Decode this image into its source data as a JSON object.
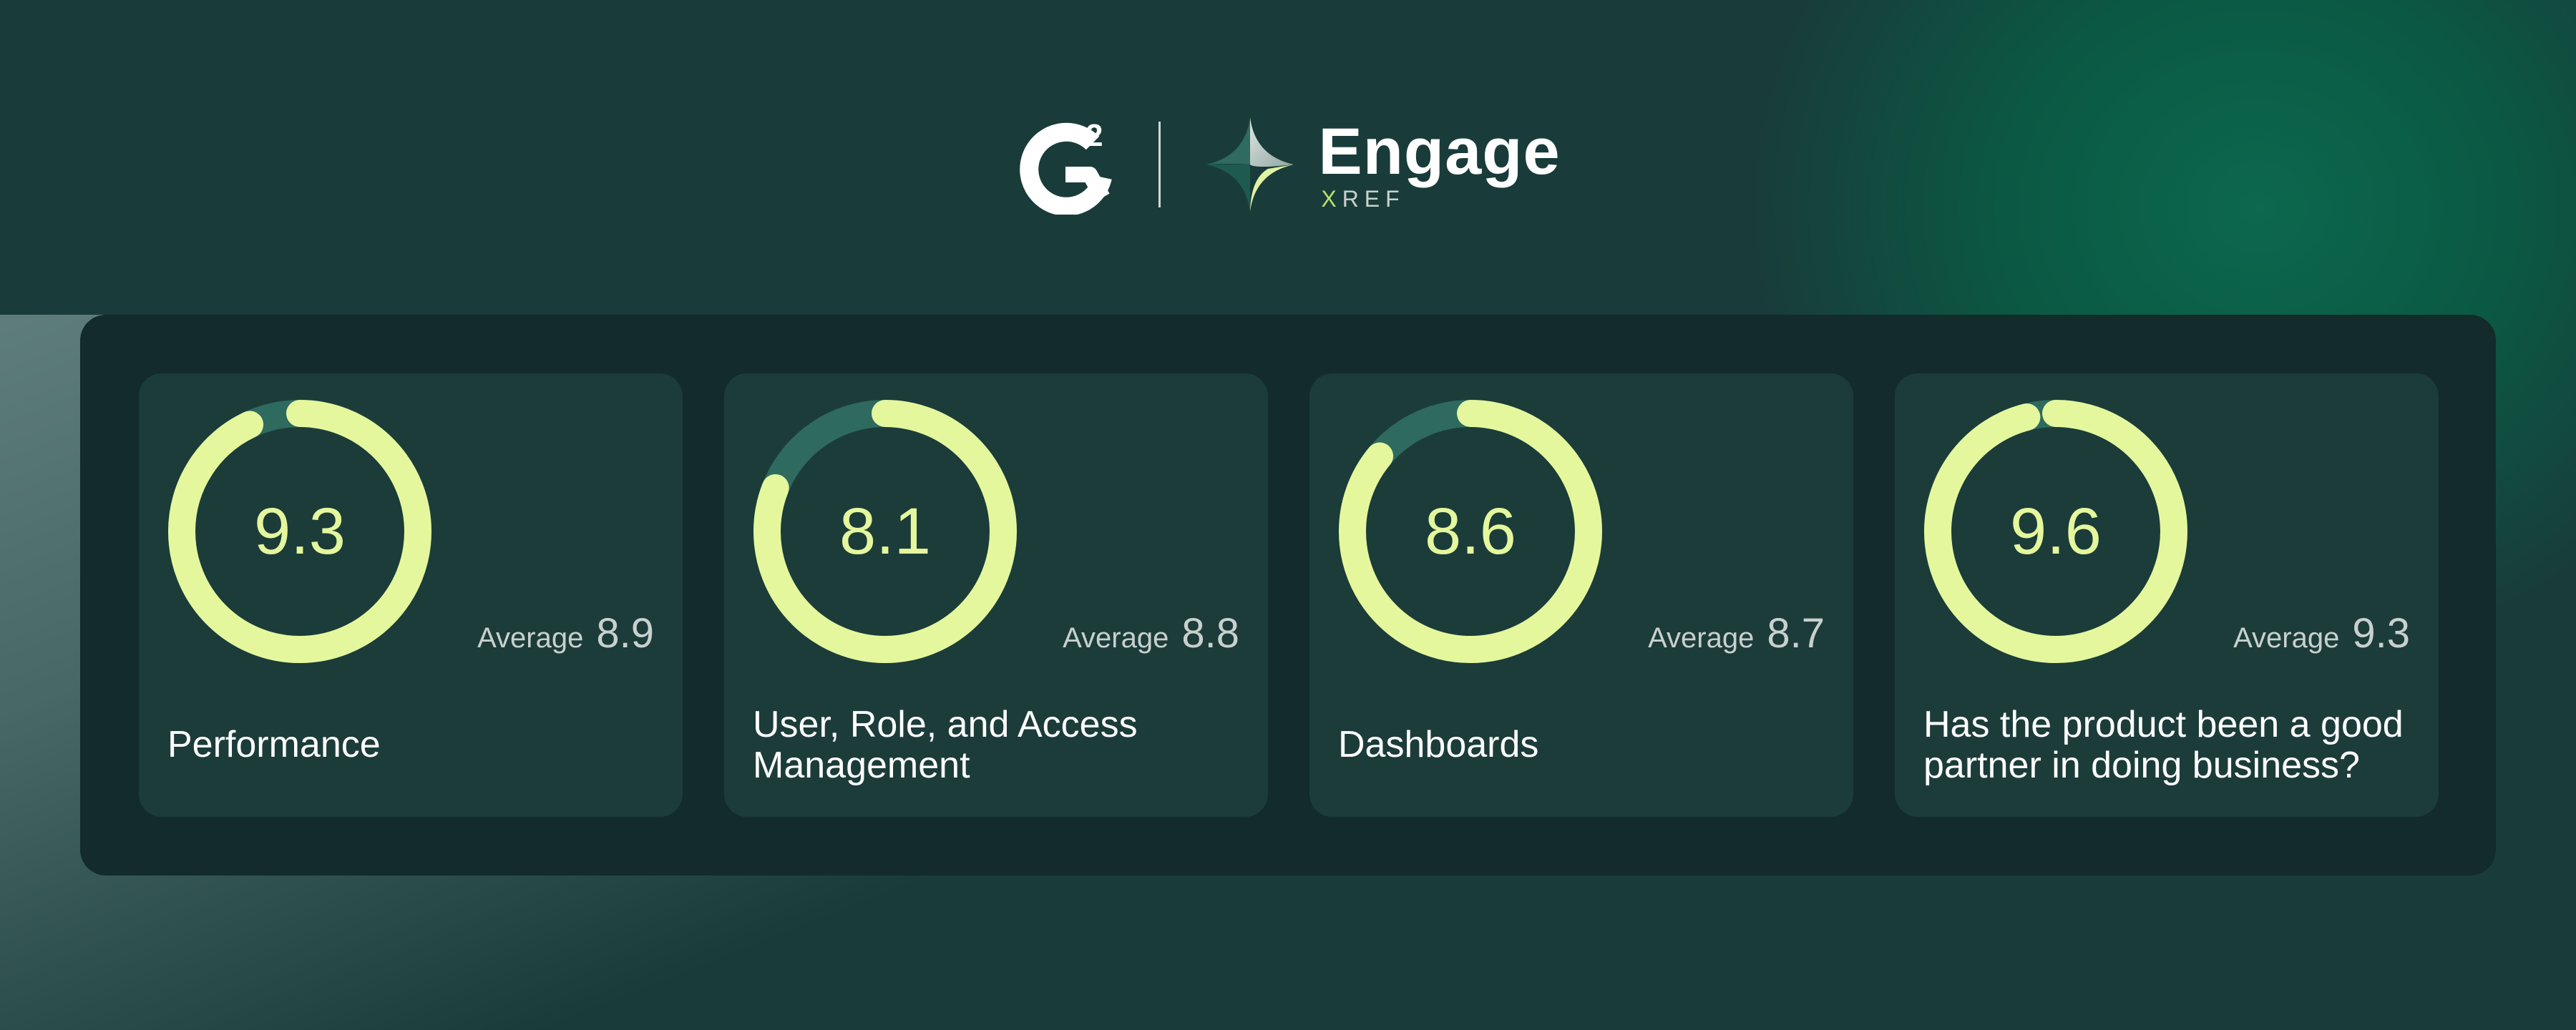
{
  "header": {
    "g2_logo": "g2-logo",
    "brand": {
      "title": "Engage",
      "subtitle_x": "X",
      "subtitle_rest": "REF"
    }
  },
  "colors": {
    "background": "#193c3a",
    "panel": "#132b2a",
    "card": "#1c3c3a",
    "ring_fill": "#e5f79d",
    "ring_track": "#2e6a5e"
  },
  "metrics": [
    {
      "score": "9.3",
      "average_label": "Average",
      "average_value": "8.9",
      "label": "Performance",
      "fill_fraction": 0.93
    },
    {
      "score": "8.1",
      "average_label": "Average",
      "average_value": "8.8",
      "label": "User, Role, and Access Management",
      "fill_fraction": 0.81
    },
    {
      "score": "8.6",
      "average_label": "Average",
      "average_value": "8.7",
      "label": "Dashboards",
      "fill_fraction": 0.86
    },
    {
      "score": "9.6",
      "average_label": "Average",
      "average_value": "9.3",
      "label": "Has the product been a good partner in doing business?",
      "fill_fraction": 0.96
    }
  ]
}
